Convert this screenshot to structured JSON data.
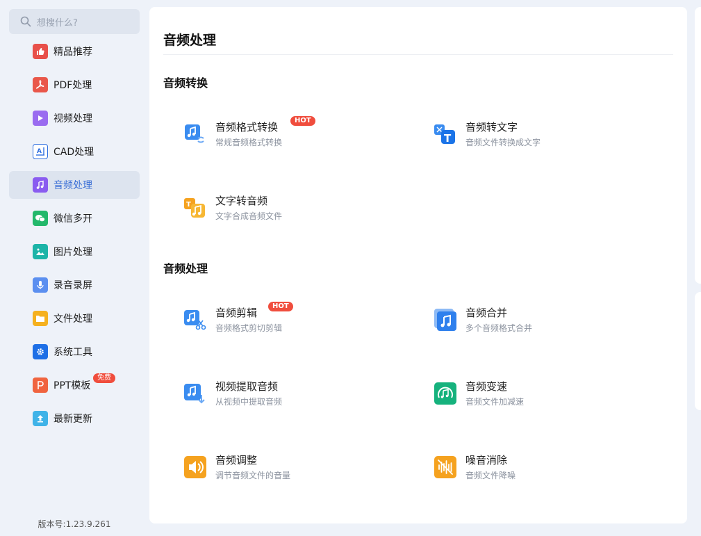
{
  "search": {
    "placeholder": "想搜什么?"
  },
  "sidebar": {
    "items": [
      {
        "label": "精品推荐",
        "icon": "thumbs-up-icon",
        "color": "#e8504a"
      },
      {
        "label": "PDF处理",
        "icon": "pdf-icon",
        "color": "#e9574a"
      },
      {
        "label": "视频处理",
        "icon": "play-icon",
        "color": "#9a6cf0"
      },
      {
        "label": "CAD处理",
        "icon": "cad-icon",
        "color": "#2f6fe0"
      },
      {
        "label": "音频处理",
        "icon": "music-note-icon",
        "color": "#8a5cf0"
      },
      {
        "label": "微信多开",
        "icon": "wechat-icon",
        "color": "#23b86b"
      },
      {
        "label": "图片处理",
        "icon": "image-icon",
        "color": "#1cb4a8"
      },
      {
        "label": "录音录屏",
        "icon": "microphone-icon",
        "color": "#5b8ff0"
      },
      {
        "label": "文件处理",
        "icon": "folder-icon",
        "color": "#f5b11f"
      },
      {
        "label": "系统工具",
        "icon": "gear-icon",
        "color": "#1e6fe6"
      },
      {
        "label": "PPT模板",
        "icon": "ppt-icon",
        "color": "#f0643f",
        "badge": "免费"
      },
      {
        "label": "最新更新",
        "icon": "upload-icon",
        "color": "#3fb3e8"
      }
    ],
    "active_index": 4,
    "version": "版本号:1.23.9.261"
  },
  "main": {
    "title": "音频处理",
    "sections": [
      {
        "title": "音频转换",
        "tools": [
          {
            "name": "音频格式转换",
            "desc": "常规音频格式转换",
            "hot": "HOT",
            "icon": "audio-convert-icon"
          },
          {
            "name": "音频转文字",
            "desc": "音频文件转换成文字",
            "icon": "audio-to-text-icon"
          },
          {
            "name": "文字转音频",
            "desc": "文字合成音频文件",
            "icon": "text-to-audio-icon"
          }
        ]
      },
      {
        "title": "音频处理",
        "tools": [
          {
            "name": "音频剪辑",
            "desc": "音频格式剪切剪辑",
            "hot": "HOT",
            "icon": "audio-cut-icon"
          },
          {
            "name": "音频合并",
            "desc": "多个音频格式合并",
            "icon": "audio-merge-icon"
          },
          {
            "name": "视频提取音频",
            "desc": "从视频中提取音频",
            "icon": "video-extract-audio-icon"
          },
          {
            "name": "音频变速",
            "desc": "音频文件加减速",
            "icon": "audio-speed-icon"
          },
          {
            "name": "音频调整",
            "desc": "调节音频文件的音量",
            "icon": "volume-icon"
          },
          {
            "name": "噪音消除",
            "desc": "音频文件降噪",
            "icon": "noise-reduction-icon"
          }
        ]
      }
    ]
  }
}
